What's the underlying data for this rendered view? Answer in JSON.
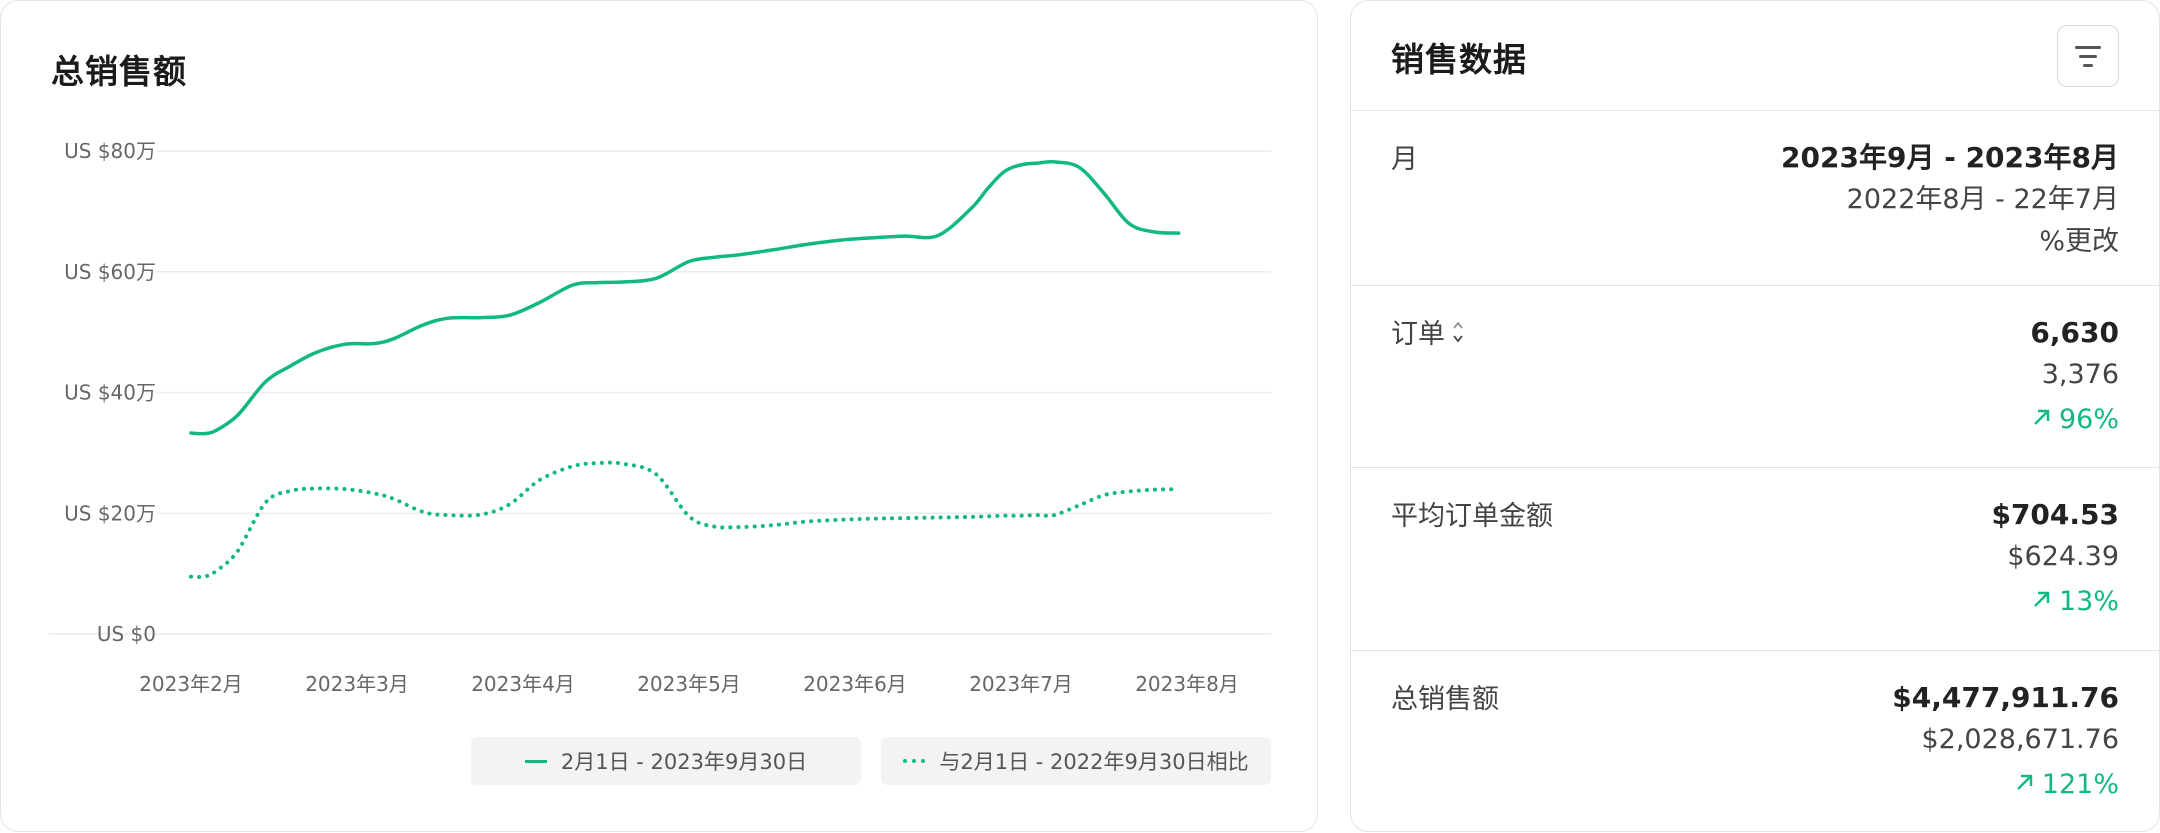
{
  "chart_title": "总销售额",
  "chart_data": {
    "type": "line",
    "categories": [
      "2023年2月",
      "2023年3月",
      "2023年4月",
      "2023年5月",
      "2023年6月",
      "2023年7月",
      "2023年8月"
    ],
    "y_ticks": [
      "US $0",
      "US $20万",
      "US $40万",
      "US $60万",
      "US $80万"
    ],
    "ylim": [
      0,
      80
    ],
    "grid": true,
    "legend_position": "bottom-right",
    "x": [
      0.0,
      0.08,
      0.15,
      0.28,
      0.45,
      0.6,
      0.75,
      0.93,
      1.1,
      1.22,
      1.4,
      1.55,
      1.75,
      1.92,
      2.1,
      2.3,
      2.45,
      2.6,
      2.8,
      3.0,
      3.15,
      3.3,
      3.5,
      3.7,
      3.9,
      4.1,
      4.3,
      4.5,
      4.7,
      4.8,
      4.9,
      5.0,
      5.1,
      5.2,
      5.35,
      5.5,
      5.65,
      5.8,
      5.95,
      6.1,
      6.2,
      6.4
    ],
    "series": [
      {
        "name": "2月1日 - 2023年9月30日",
        "style": "solid",
        "values": [
          33.3,
          33.2,
          33.7,
          36.2,
          41.8,
          44.4,
          46.6,
          48.0,
          48.1,
          48.9,
          51.2,
          52.3,
          52.4,
          52.8,
          54.9,
          57.8,
          58.2,
          58.3,
          58.9,
          61.7,
          62.4,
          62.8,
          63.6,
          64.5,
          65.2,
          65.6,
          65.9,
          66.0,
          70.5,
          73.8,
          76.6,
          77.7,
          78.0,
          78.2,
          77.3,
          73.0,
          68.0,
          66.6,
          66.4,
          null,
          null,
          null
        ]
      },
      {
        "name": "与2月1日 - 2022年9月30日相比",
        "style": "dotted",
        "values": [
          9.5,
          9.5,
          10.4,
          13.7,
          21.8,
          23.7,
          24.1,
          24.0,
          23.3,
          22.4,
          20.2,
          19.7,
          19.8,
          21.5,
          25.5,
          27.8,
          28.3,
          28.2,
          26.5,
          19.5,
          17.8,
          17.7,
          18.0,
          18.6,
          18.9,
          19.1,
          19.2,
          19.3,
          19.4,
          19.5,
          19.6,
          19.6,
          19.7,
          19.7,
          21.3,
          23.0,
          23.6,
          23.9,
          24.0,
          null,
          null,
          null
        ]
      }
    ],
    "colors": {
      "line": "#11b981"
    }
  },
  "legend": {
    "current": "2月1日 - 2023年9月30日",
    "previous": "与2月1日 - 2022年9月30日相比"
  },
  "stats": {
    "title": "销售数据",
    "filter_icon": "filter-icon",
    "period": {
      "label": "月",
      "current": "2023年9月 - 2023年8月",
      "previous": "2022年8月 - 22年7月",
      "change_label": "%更改"
    },
    "rows": [
      {
        "label": "订单",
        "current": "6,630",
        "previous": "3,376",
        "change": "96%",
        "sortable": true
      },
      {
        "label": "平均订单金额",
        "current": "$704.53",
        "previous": "$624.39",
        "change": "13%",
        "sortable": false
      },
      {
        "label": "总销售额",
        "current": "$4,477,911.76",
        "previous": "$2,028,671.76",
        "change": "121%",
        "sortable": false
      }
    ],
    "accent": "#11b981"
  }
}
